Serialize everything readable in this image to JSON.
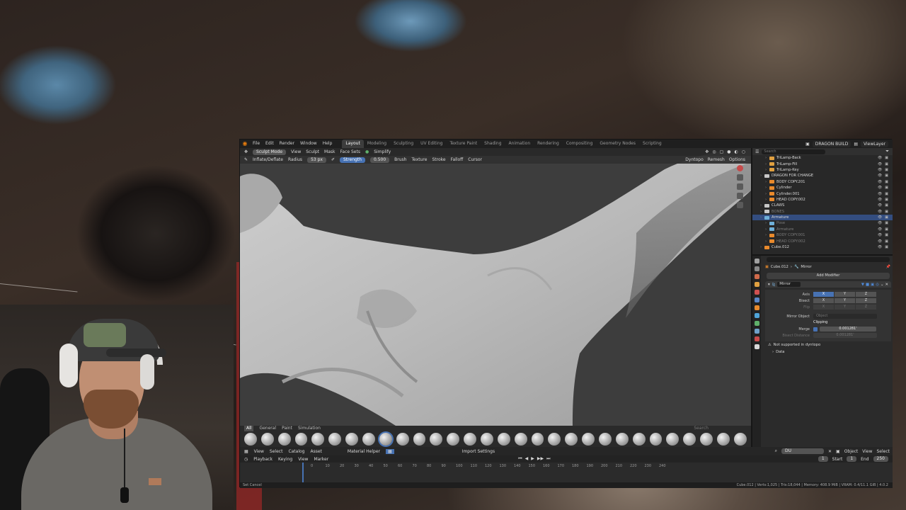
{
  "topbar": {
    "menus": [
      "File",
      "Edit",
      "Render",
      "Window",
      "Help"
    ],
    "workspaces": [
      {
        "label": "Layout",
        "active": true
      },
      {
        "label": "Modeling",
        "active": false
      },
      {
        "label": "Sculpting",
        "active": false
      },
      {
        "label": "UV Editing",
        "active": false
      },
      {
        "label": "Texture Paint",
        "active": false
      },
      {
        "label": "Shading",
        "active": false
      },
      {
        "label": "Animation",
        "active": false
      },
      {
        "label": "Rendering",
        "active": false
      },
      {
        "label": "Compositing",
        "active": false
      },
      {
        "label": "Geometry Nodes",
        "active": false
      },
      {
        "label": "Scripting",
        "active": false
      }
    ],
    "scene": "DRAGON BUILD",
    "view_layer": "ViewLayer"
  },
  "viewport": {
    "mode": "Sculpt Mode",
    "menus": [
      "View",
      "Sculpt",
      "Mask",
      "Face Sets"
    ],
    "simplify": "Simplify",
    "brush_name": "Inflate/Deflate",
    "radius_label": "Radius",
    "radius_value": "53 px",
    "strength_label": "Strength",
    "strength_value": "0.500",
    "tool_menus": [
      "Brush",
      "Texture",
      "Stroke",
      "Falloff",
      "Cursor"
    ],
    "dyntopo": "Dyntopo",
    "remesh": "Remesh",
    "options": "Options"
  },
  "brush_shelf": {
    "tabs": [
      {
        "label": "All",
        "active": true
      },
      {
        "label": "General",
        "active": false
      },
      {
        "label": "Paint",
        "active": false
      },
      {
        "label": "Simulation",
        "active": false
      }
    ],
    "search_placeholder": "Search",
    "brush_count": 30,
    "active_index": 8
  },
  "node_bar": {
    "menus": [
      "View",
      "Select",
      "Catalog",
      "Asset"
    ],
    "material_helper": "Material Helper",
    "import_settings": "Import Settings",
    "search_value": "DU",
    "object_menu": "Object",
    "right_menus": [
      "View",
      "Select"
    ]
  },
  "timeline": {
    "menus": [
      "Playback",
      "Keying",
      "View",
      "Marker"
    ],
    "current_frame": "1",
    "start_label": "Start",
    "start_value": "1",
    "end_label": "End",
    "end_value": "250",
    "ticks": [
      "0",
      "10",
      "20",
      "30",
      "40",
      "50",
      "60",
      "70",
      "80",
      "90",
      "100",
      "110",
      "120",
      "130",
      "140",
      "150",
      "160",
      "170",
      "180",
      "190",
      "200",
      "210",
      "220",
      "230",
      "240"
    ],
    "status_left": "Set Cancel",
    "status_right": "Cube.012 | Verts:1,025 | Tris:18,044 | Memory: 408.9 MiB | VRAM: 0.4/11.1 GiB | 4.0.2"
  },
  "outliner": {
    "search_placeholder": "Search",
    "rows": [
      {
        "label": "TriLamp-Back",
        "indent": 2,
        "icon_color": "#e0a040",
        "dim": false,
        "selected": false
      },
      {
        "label": "TriLamp-Fill",
        "indent": 2,
        "icon_color": "#e0a040",
        "dim": false,
        "selected": false
      },
      {
        "label": "TriLamp-Key",
        "indent": 2,
        "icon_color": "#e0a040",
        "dim": false,
        "selected": false
      },
      {
        "label": "DRAGON FOR CHANGE",
        "indent": 1,
        "icon_color": "#c8c8c8",
        "dim": false,
        "selected": false
      },
      {
        "label": "BODY COPY.201",
        "indent": 2,
        "icon_color": "#e98a2c",
        "dim": false,
        "selected": false
      },
      {
        "label": "Cylinder",
        "indent": 2,
        "icon_color": "#e98a2c",
        "dim": false,
        "selected": false
      },
      {
        "label": "Cylinder.001",
        "indent": 2,
        "icon_color": "#e98a2c",
        "dim": false,
        "selected": false
      },
      {
        "label": "HEAD COPY.002",
        "indent": 2,
        "icon_color": "#e98a2c",
        "dim": false,
        "selected": false
      },
      {
        "label": "CLAWS",
        "indent": 1,
        "icon_color": "#c8c8c8",
        "dim": false,
        "selected": false
      },
      {
        "label": "BONES",
        "indent": 1,
        "icon_color": "#c8c8c8",
        "dim": true,
        "selected": false
      },
      {
        "label": "Armature",
        "indent": 1,
        "icon_color": "#6fb0d8",
        "dim": false,
        "selected": true
      },
      {
        "label": "Pose",
        "indent": 2,
        "icon_color": "#6fb0d8",
        "dim": true,
        "selected": false
      },
      {
        "label": "Armature",
        "indent": 2,
        "icon_color": "#6fb0d8",
        "dim": true,
        "selected": false
      },
      {
        "label": "BODY COPY.001",
        "indent": 2,
        "icon_color": "#e98a2c",
        "dim": true,
        "selected": false
      },
      {
        "label": "HEAD COPY.002",
        "indent": 2,
        "icon_color": "#e98a2c",
        "dim": true,
        "selected": false
      },
      {
        "label": "Cube.012",
        "indent": 1,
        "icon_color": "#e98a2c",
        "dim": false,
        "selected": false
      }
    ]
  },
  "properties": {
    "object": "Cube.012",
    "modifier_crumb": "Mirror",
    "add_modifier": "Add Modifier",
    "modifier_name": "Mirror",
    "axis_label": "Axis",
    "bisect_label": "Bisect",
    "flip_label": "Flip",
    "axes": [
      "X",
      "Y",
      "Z"
    ],
    "mirror_object_label": "Mirror Object",
    "mirror_object_placeholder": "Object",
    "clipping_label": "Clipping",
    "merge_label": "Merge",
    "merge_value": "0.001281'",
    "bisect_distance_label": "Bisect Distance",
    "bisect_distance_value": "0.001281'",
    "warning": "Not supported in dyntopo",
    "data_label": "Data",
    "tab_colors": [
      "#a0a0a0",
      "#8a8a8a",
      "#d06a4a",
      "#e0a040",
      "#cf5050",
      "#5a86c8",
      "#e98a2c",
      "#4fa4d8",
      "#5fb06a",
      "#6fa0c8",
      "#c84a4a",
      "#d8d8d8"
    ]
  },
  "colors": {
    "accent_blue": "#4772b3",
    "blender_orange": "#e87d0d",
    "overlay_red": "#be2828"
  }
}
